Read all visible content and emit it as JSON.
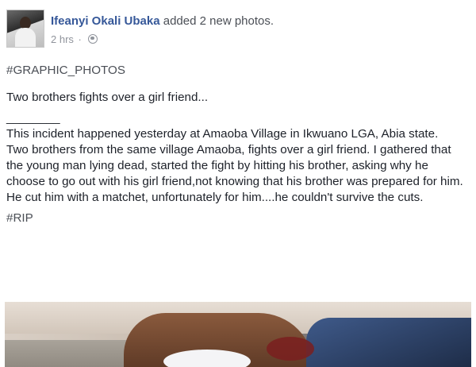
{
  "post": {
    "author": "Ifeanyi Okali Ubaka",
    "action": " added 2 new photos.",
    "time": "2 hrs",
    "separator": "·",
    "privacy_icon": "globe-icon",
    "hashtag_top": "#GRAPHIC_PHOTOS",
    "title_line": "Two brothers fights over a girl friend...",
    "divider_line": "________",
    "paragraph1": "This incident happened yesterday at Amaoba Village in Ikwuano LGA, Abia state.",
    "paragraph2": "Two brothers from the same village Amaoba, fights over a girl friend. I gathered that the young man lying dead, started the fight by hitting his brother, asking why he choose to go out with his girl friend,not knowing that his brother was prepared for him.",
    "paragraph3": "He cut him with a matchet, unfortunately for him....he couldn't survive the cuts.",
    "hashtag_bottom": "#RIP"
  }
}
